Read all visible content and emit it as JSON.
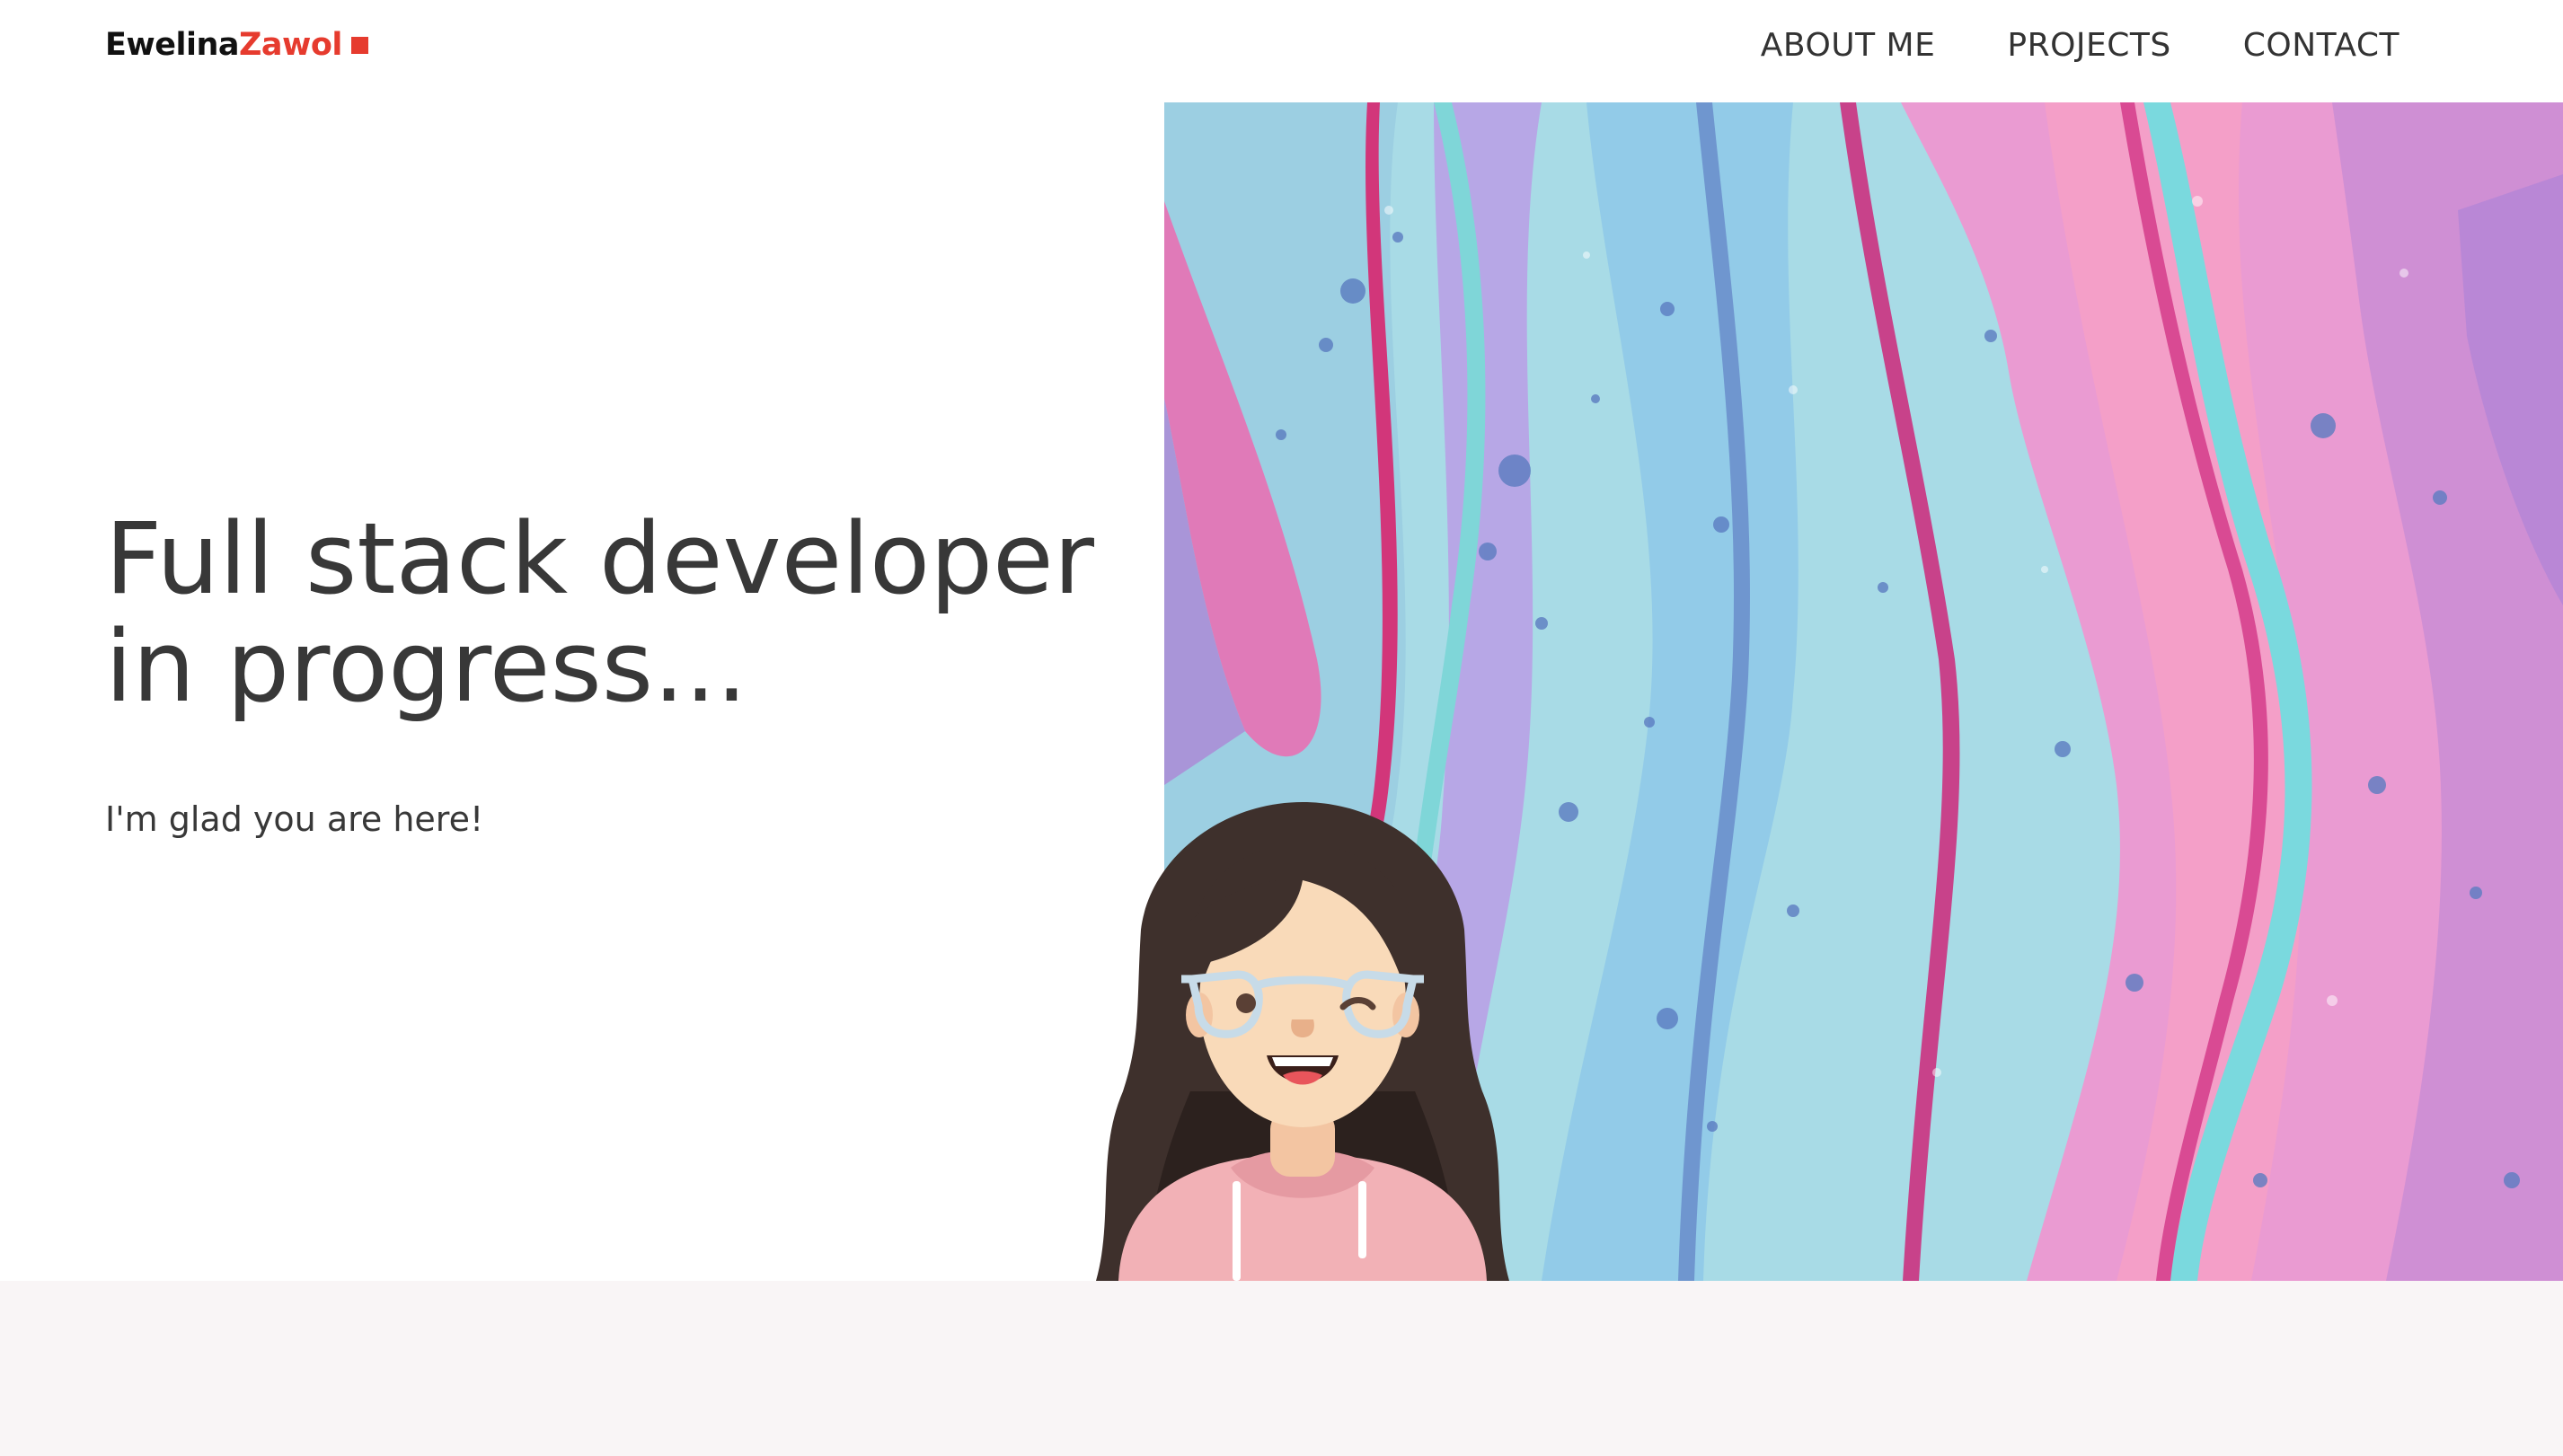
{
  "brand": {
    "first": "Ewelina",
    "last": "Zawol",
    "accent": "#e63b2e"
  },
  "nav": {
    "about": "ABOUT ME",
    "projects": "PROJECTS",
    "contact": "CONTACT"
  },
  "hero": {
    "title_line1": "Full stack developer",
    "title_line2": "in progress...",
    "subtitle": "I'm glad you are here!"
  },
  "icons": {
    "avatar": "girl-with-glasses-avatar",
    "background": "fluid-paint-art",
    "logo_mark": "red-square-icon"
  }
}
